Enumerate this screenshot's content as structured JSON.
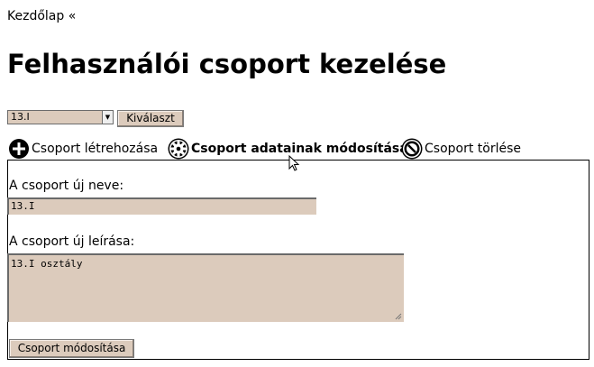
{
  "breadcrumb": {
    "label": "Kezdőlap «"
  },
  "page": {
    "title": "Felhasználói csoport kezelése"
  },
  "group_select": {
    "selected": "13.I",
    "button_label": "Kiválaszt"
  },
  "tabs": [
    {
      "label": "Csoport létrehozása",
      "icon": "plus-circle-icon"
    },
    {
      "label": "Csoport adatainak módosítása",
      "icon": "gear-icon",
      "active": true
    },
    {
      "label": "Csoport törlése",
      "icon": "no-entry-icon"
    }
  ],
  "form": {
    "name_label": "A csoport új neve:",
    "name_value": "13.I",
    "desc_label": "A csoport új leírása:",
    "desc_value": "13.I osztály",
    "submit_label": "Csoport módosítása"
  },
  "colors": {
    "input_bg": "#dccbbc",
    "border": "#000000"
  }
}
